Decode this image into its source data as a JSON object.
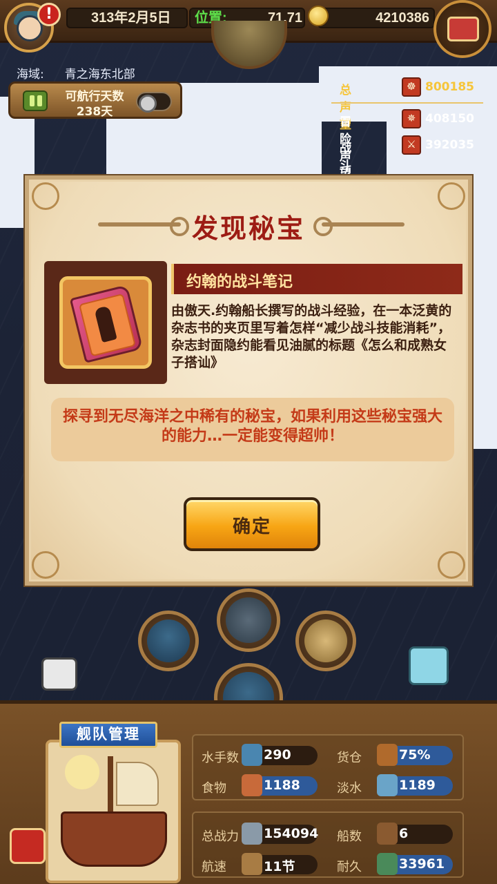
{
  "hud": {
    "date": "313年2月5日",
    "position_label": "位置:",
    "position_value": "71,71",
    "gold": "4210386",
    "alert_glyph": "!"
  },
  "region": {
    "label": "海域:",
    "value": "青之海东北部"
  },
  "sail_days": {
    "label": "可航行天数",
    "value": "238天"
  },
  "reputation": {
    "total": {
      "label": "总声望",
      "value": "800185"
    },
    "adventure": {
      "label": "冒险声望",
      "value": "408150"
    },
    "battle": {
      "label": "战斗声望",
      "value": "392035"
    }
  },
  "dialog": {
    "title": "发现秘宝",
    "item_name": "约翰的战斗笔记",
    "item_description": "由傲天.约翰船长撰写的战斗经验，在一本泛黄的杂志书的夹页里写着怎样“减少战斗技能消耗”，杂志封面隐约能看见油腻的标题《怎么和成熟女子搭讪》",
    "flavor": "探寻到无尽海洋之中稀有的秘宝，如果利用这些秘宝强大的能力…一定能变得超帅！",
    "confirm_label": "确定"
  },
  "fleet": {
    "title": "舰队管理",
    "stats": {
      "sailors": {
        "label": "水手数",
        "value": "290"
      },
      "cargo": {
        "label": "货仓",
        "value": "75%"
      },
      "food": {
        "label": "食物",
        "value": "1188"
      },
      "water": {
        "label": "淡水",
        "value": "1189"
      },
      "power": {
        "label": "总战力",
        "value": "154094"
      },
      "ships": {
        "label": "船数",
        "value": "6"
      },
      "speed": {
        "label": "航速",
        "value": "11节"
      },
      "durability": {
        "label": "耐久",
        "value": "33961"
      }
    }
  },
  "colors": {
    "accent_gold": "#f6c53a",
    "title_red": "#9d1c14",
    "button_orange": "#f7a514"
  }
}
